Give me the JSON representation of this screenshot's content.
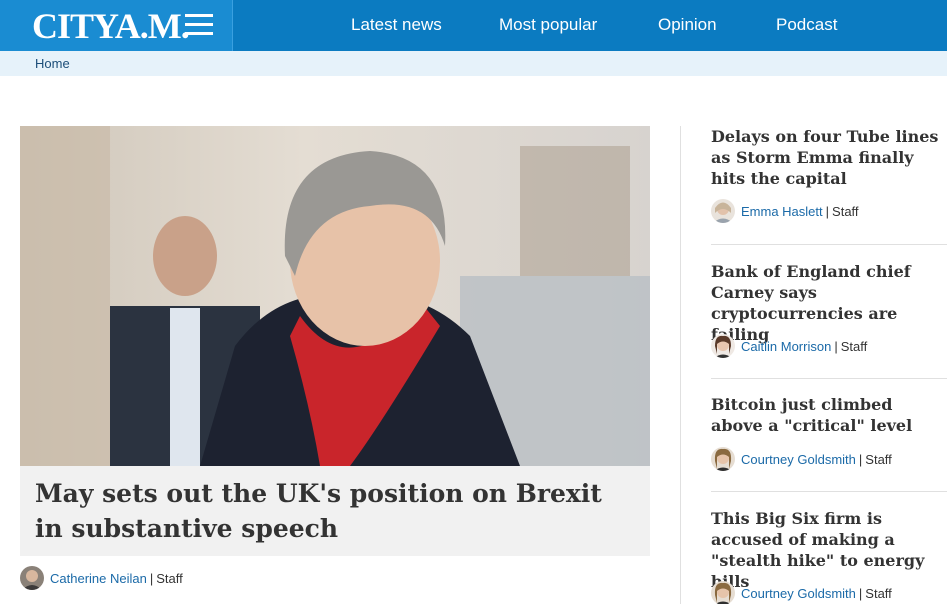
{
  "header": {
    "logo": "CITYA.M.",
    "nav": [
      "Latest news",
      "Most popular",
      "Opinion",
      "Podcast"
    ],
    "colors": {
      "bar": "#0b7bc1",
      "logo_box": "#1a8cd2"
    }
  },
  "breadcrumb": {
    "home": "Home"
  },
  "hero": {
    "title": "May sets out the UK's position on Brexit in substantive speech",
    "author": "Catherine Neilan",
    "role": "Staff",
    "separator": "|"
  },
  "sidebar": {
    "articles": [
      {
        "title": "Delays on four Tube lines as Storm Emma finally hits the capital",
        "author": "Emma Haslett",
        "role": "Staff"
      },
      {
        "title": "Bank of England chief Carney says cryptocurrencies are failing",
        "author": "Caitlin Morrison",
        "role": "Staff"
      },
      {
        "title": "Bitcoin just climbed above a \"critical\" level",
        "author": "Courtney Goldsmith",
        "role": "Staff"
      },
      {
        "title": "This Big Six firm is accused of making a \"stealth hike\" to energy bills",
        "author": "Courtney Goldsmith",
        "role": "Staff"
      }
    ]
  }
}
